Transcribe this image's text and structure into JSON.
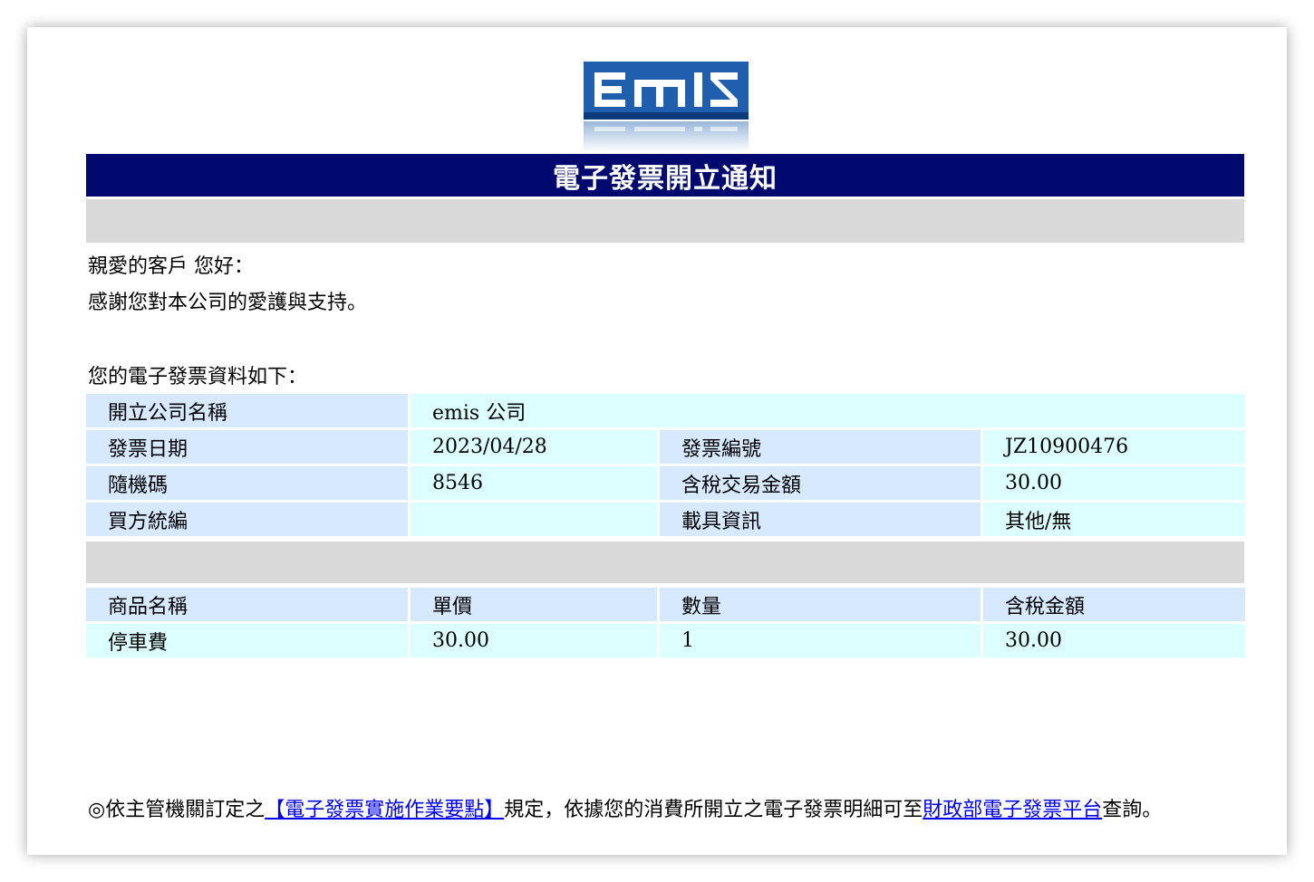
{
  "logo": {
    "text": "EMIS",
    "brand_color": "#1f5fae"
  },
  "header": {
    "title": "電子發票開立通知"
  },
  "greeting": {
    "line1": "親愛的客戶 您好：",
    "line2": "感謝您對本公司的愛護與支持。"
  },
  "info": {
    "intro": "您的電子發票資料如下：",
    "company_label": "開立公司名稱",
    "company_value": "emis 公司",
    "date_label": "發票日期",
    "date_value": "2023/04/28",
    "invoice_no_label": "發票編號",
    "invoice_no_value": "JZ10900476",
    "random_label": "隨機碼",
    "random_value": "8546",
    "amount_label": "含稅交易金額",
    "amount_value": "30.00",
    "buyer_label": "買方統編",
    "buyer_value": "",
    "carrier_label": "載具資訊",
    "carrier_value": "其他/無"
  },
  "items": {
    "headers": [
      "商品名稱",
      "單價",
      "數量",
      "含稅金額"
    ],
    "rows": [
      [
        "停車費",
        "30.00",
        "1",
        "30.00"
      ]
    ]
  },
  "footer": {
    "prefix": "◎依主管機關訂定之",
    "link1": "【電子發票實施作業要點】",
    "middle": "規定，依據您的消費所開立之電子發票明細可至",
    "link2": "財政部電子發票平台",
    "suffix": "查詢。"
  },
  "colors": {
    "title_bar": "#000a6e",
    "label_cell": "#d6e9ff",
    "value_cell": "#dcffff",
    "gray_bar": "#d9d9d9",
    "link": "#0000ee"
  }
}
